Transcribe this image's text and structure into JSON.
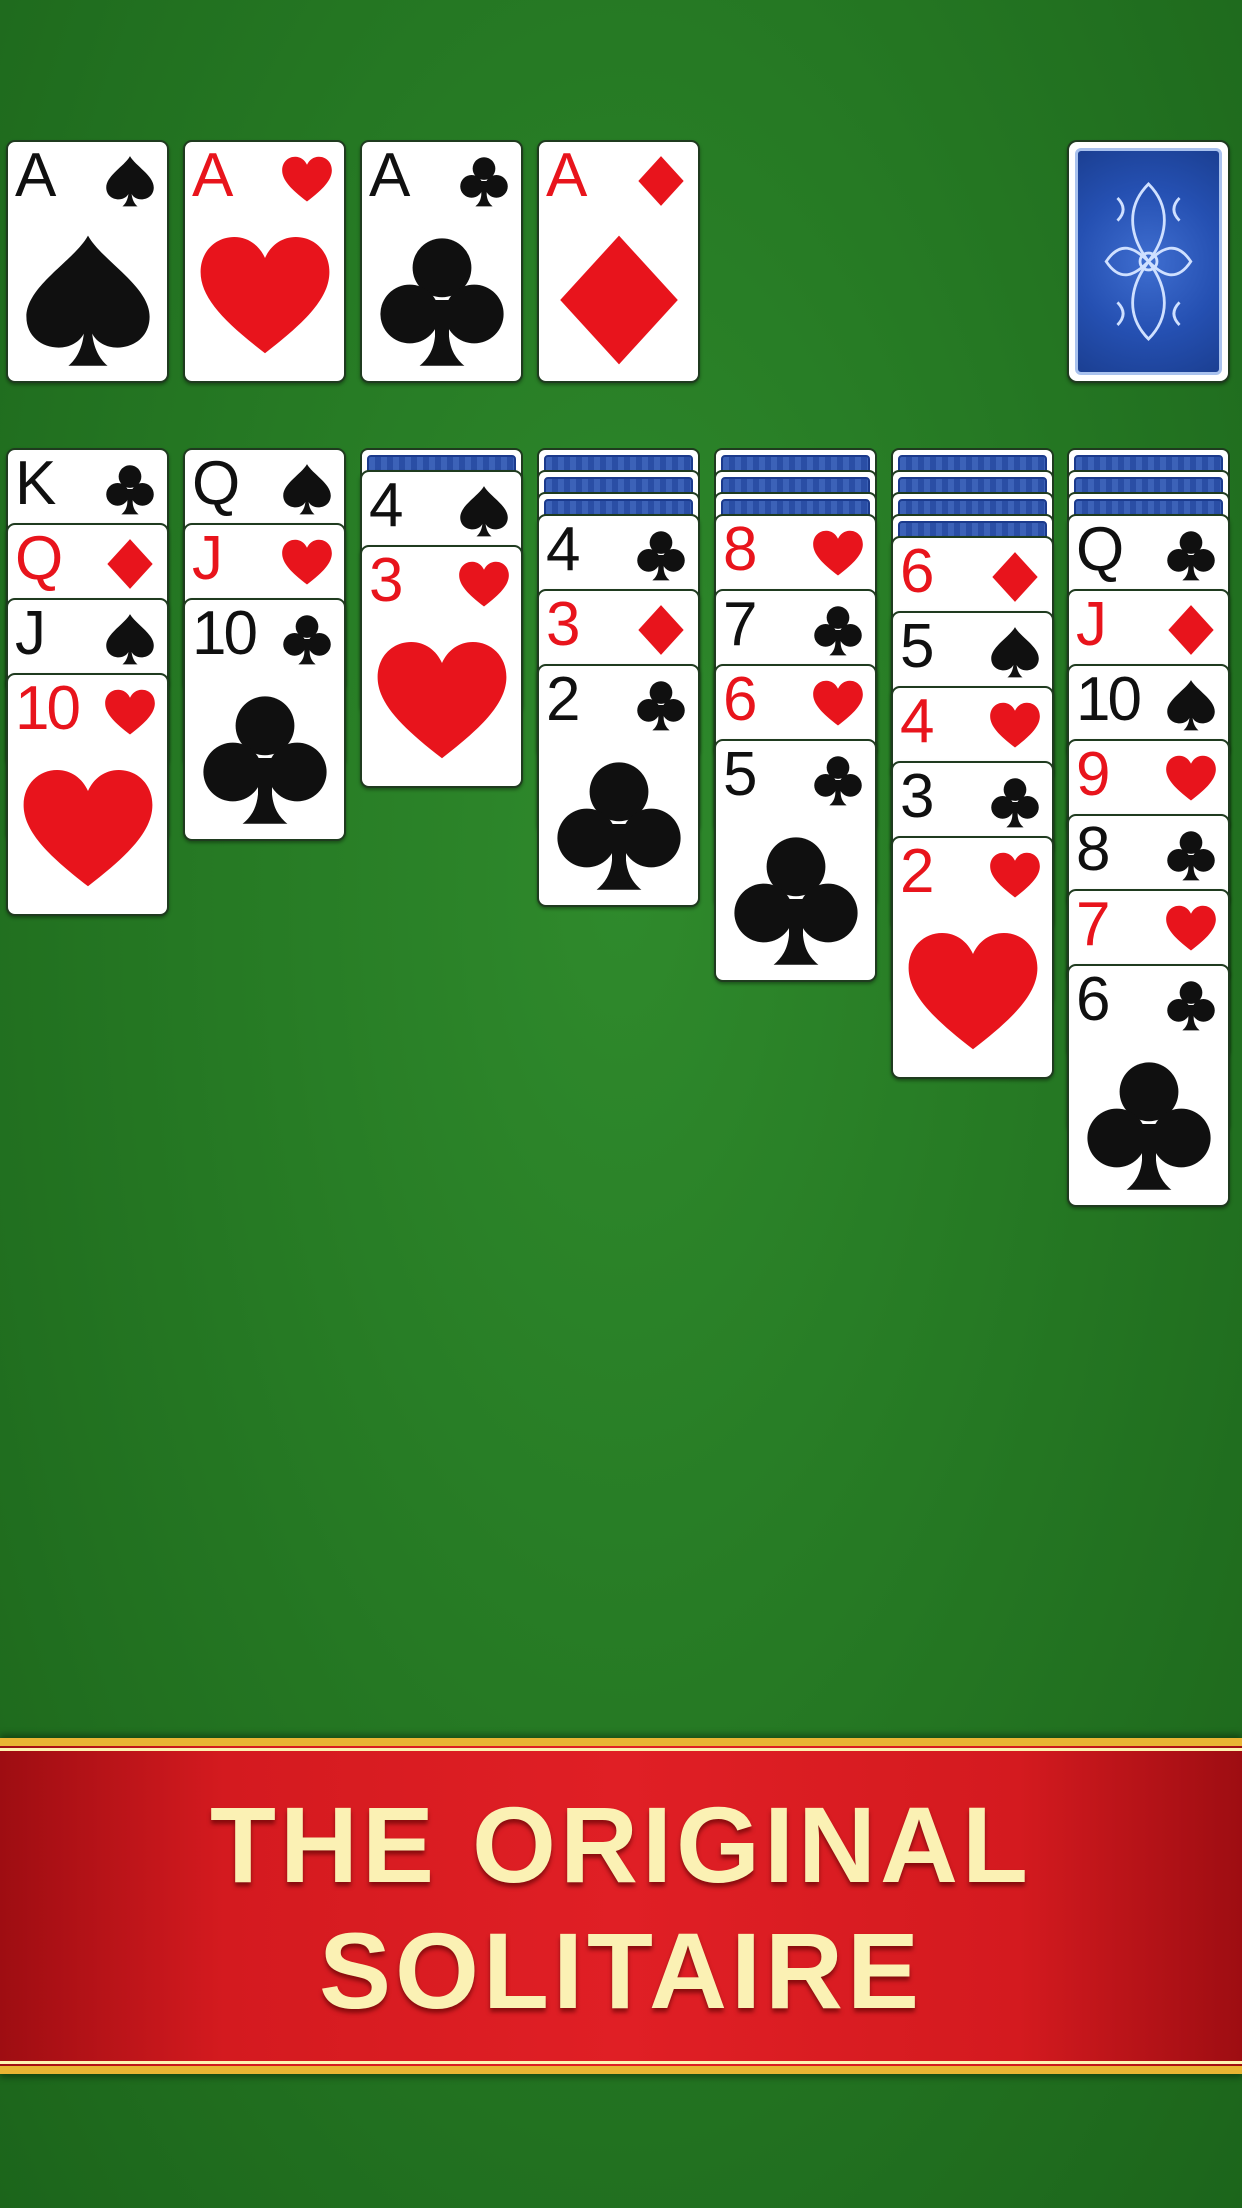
{
  "colors": {
    "felt": "#267a24",
    "red_suit": "#e8141c",
    "black_suit": "#101010",
    "banner_red": "#e01f25",
    "banner_text": "#fbf1b4",
    "banner_trim": "#e9b533"
  },
  "foundations": [
    {
      "rank": "A",
      "suit": "spade"
    },
    {
      "rank": "A",
      "suit": "heart"
    },
    {
      "rank": "A",
      "suit": "club"
    },
    {
      "rank": "A",
      "suit": "diamond"
    }
  ],
  "stock": {
    "face": "down"
  },
  "tableau": [
    {
      "hidden": 0,
      "cards": [
        {
          "rank": "K",
          "suit": "club"
        },
        {
          "rank": "Q",
          "suit": "diamond"
        },
        {
          "rank": "J",
          "suit": "spade"
        },
        {
          "rank": "10",
          "suit": "heart"
        }
      ]
    },
    {
      "hidden": 0,
      "cards": [
        {
          "rank": "Q",
          "suit": "spade"
        },
        {
          "rank": "J",
          "suit": "heart"
        },
        {
          "rank": "10",
          "suit": "club"
        }
      ]
    },
    {
      "hidden": 1,
      "cards": [
        {
          "rank": "4",
          "suit": "spade"
        },
        {
          "rank": "3",
          "suit": "heart"
        }
      ]
    },
    {
      "hidden": 3,
      "cards": [
        {
          "rank": "4",
          "suit": "club"
        },
        {
          "rank": "3",
          "suit": "diamond"
        },
        {
          "rank": "2",
          "suit": "club"
        }
      ]
    },
    {
      "hidden": 3,
      "cards": [
        {
          "rank": "8",
          "suit": "heart"
        },
        {
          "rank": "7",
          "suit": "club"
        },
        {
          "rank": "6",
          "suit": "heart"
        },
        {
          "rank": "5",
          "suit": "club"
        }
      ]
    },
    {
      "hidden": 4,
      "cards": [
        {
          "rank": "6",
          "suit": "diamond"
        },
        {
          "rank": "5",
          "suit": "spade"
        },
        {
          "rank": "4",
          "suit": "heart"
        },
        {
          "rank": "3",
          "suit": "club"
        },
        {
          "rank": "2",
          "suit": "heart"
        }
      ]
    },
    {
      "hidden": 3,
      "cards": [
        {
          "rank": "Q",
          "suit": "club"
        },
        {
          "rank": "J",
          "suit": "diamond"
        },
        {
          "rank": "10",
          "suit": "spade"
        },
        {
          "rank": "9",
          "suit": "heart"
        },
        {
          "rank": "8",
          "suit": "club"
        },
        {
          "rank": "7",
          "suit": "heart"
        },
        {
          "rank": "6",
          "suit": "club"
        }
      ]
    }
  ],
  "banner": {
    "line1": "THE ORIGINAL",
    "line2": "SOLITAIRE"
  }
}
